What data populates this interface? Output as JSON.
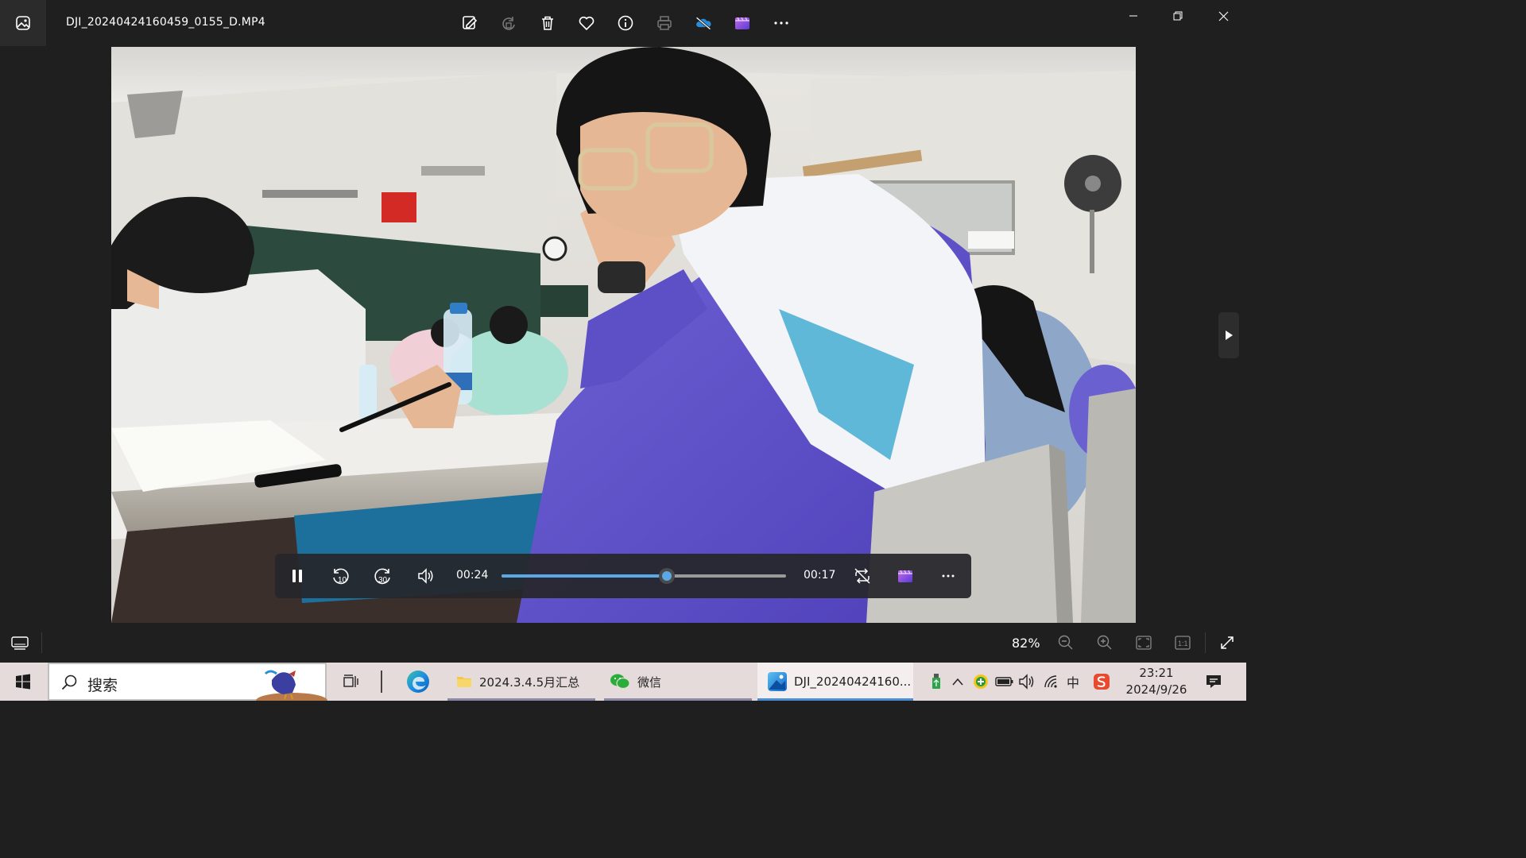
{
  "window": {
    "file_title": "DJI_20240424160459_0155_D.MP4",
    "toolbar": [
      {
        "name": "edit-icon"
      },
      {
        "name": "rotate-icon"
      },
      {
        "name": "delete-icon"
      },
      {
        "name": "favorite-icon"
      },
      {
        "name": "info-icon"
      },
      {
        "name": "print-icon"
      },
      {
        "name": "onedrive-icon"
      },
      {
        "name": "clipchamp-icon"
      },
      {
        "name": "more-icon"
      }
    ]
  },
  "player": {
    "elapsed": "00:24",
    "remaining": "00:17",
    "progress": 0.58,
    "skip_back": "10",
    "skip_forward": "30"
  },
  "statusbar": {
    "zoom": "82%"
  },
  "taskbar": {
    "search_placeholder": "搜索",
    "items": [
      {
        "name": "task-view",
        "label": ""
      },
      {
        "name": "edge",
        "label": ""
      },
      {
        "name": "folder",
        "label": "2024.3.4.5月汇总"
      },
      {
        "name": "wechat",
        "label": "微信"
      },
      {
        "name": "photos",
        "label": "DJI_20240424160..."
      }
    ],
    "tray_ime": "中",
    "time": "23:21",
    "date": "2024/9/26"
  },
  "colors": {
    "accent": "#5aa9e6",
    "taskbar": "#e6dbdb",
    "chrome": "#1f1f1f"
  }
}
